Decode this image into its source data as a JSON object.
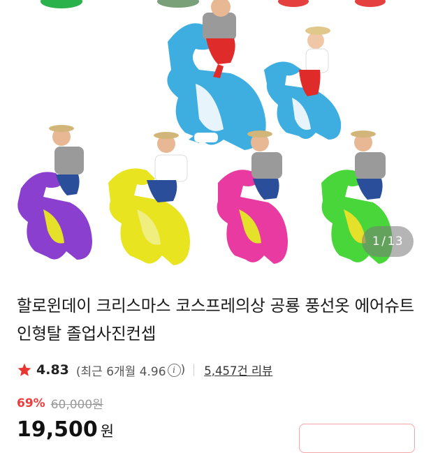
{
  "gallery": {
    "image_description_icon": "product-image",
    "counter_current": "1",
    "counter_separator": "/",
    "counter_total": "13"
  },
  "product": {
    "title": "할로윈데이 크리스마스 코스프레의상 공룡 풍선옷 에어슈트 인형탈 졸업사진컨셉",
    "rating": {
      "icon": "star-icon",
      "score": "4.83",
      "recent": "(최근 6개월 4.96",
      "info_symbol": "i",
      "recent_close": ")",
      "review_count_label": "5,457건 리뷰"
    },
    "price": {
      "discount": "69%",
      "original": "60,000원",
      "final_amount": "19,500",
      "final_unit": "원"
    }
  },
  "colors": {
    "accent_red": "#ef3b3b",
    "star_red": "#e8352f"
  }
}
